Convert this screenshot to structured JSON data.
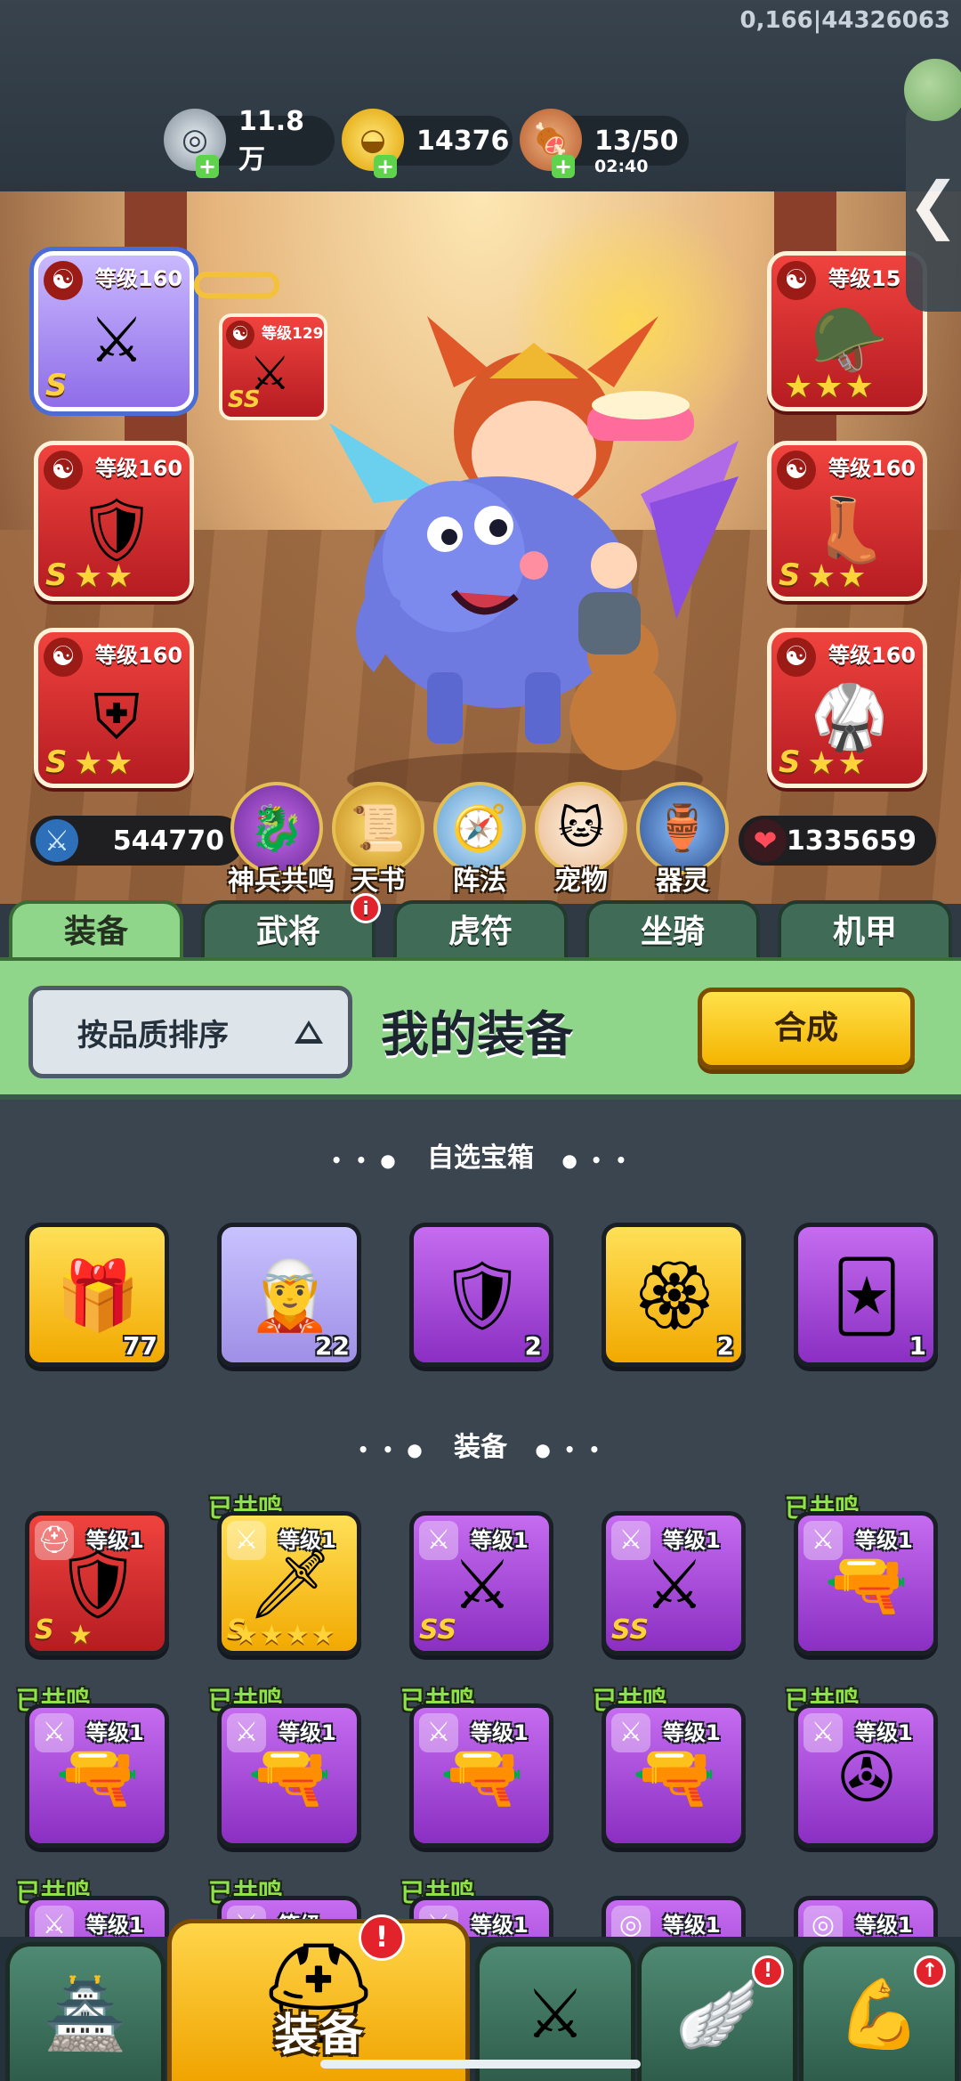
{
  "debug_text": "0,166|44326063",
  "resources": [
    {
      "name": "silver-coin-icon",
      "value": "11.8万",
      "sub": ""
    },
    {
      "name": "gold-ingot-icon",
      "value": "14376",
      "sub": ""
    },
    {
      "name": "meat-stamina-icon",
      "value": "13/50",
      "sub": "02:40"
    }
  ],
  "side_tab_arrow": "❮",
  "equipment_slots": [
    {
      "level": "等级160",
      "grade": "S",
      "stars": 0,
      "icon": "⚔",
      "yin": "☯"
    },
    {
      "level": "等级160",
      "grade": "S",
      "stars": 2,
      "icon": "🛡",
      "yin": "☯"
    },
    {
      "level": "等级160",
      "grade": "S",
      "stars": 2,
      "icon": "⛨",
      "yin": "☯"
    },
    {
      "level": "等级15",
      "grade": "",
      "stars": 3,
      "icon": "🪖",
      "yin": "☯"
    },
    {
      "level": "等级160",
      "grade": "S",
      "stars": 2,
      "icon": "👢",
      "yin": "☯"
    },
    {
      "level": "等级160",
      "grade": "S",
      "stars": 2,
      "icon": "🥋",
      "yin": "☯"
    }
  ],
  "mini_slot": {
    "level": "等级129",
    "grade": "SS",
    "icon": "⚔",
    "yin": "☯"
  },
  "power": "544770",
  "hp": "1335659",
  "features": [
    {
      "label": "神兵共鸣",
      "icon": "🐉"
    },
    {
      "label": "天书",
      "icon": "📜"
    },
    {
      "label": "阵法",
      "icon": "🧭"
    },
    {
      "label": "宠物",
      "icon": "🐱"
    },
    {
      "label": "器灵",
      "icon": "🏺"
    }
  ],
  "category_tabs": [
    "装备",
    "武将",
    "虎符",
    "坐骑",
    "机甲"
  ],
  "tab_badge": "i",
  "sort_label": "按品质排序",
  "panel_title": "我的装备",
  "combine_label": "合成",
  "section_chest": "自选宝箱",
  "section_equip": "装备",
  "section_dots": "• • ●",
  "section_dots_right": "● • •",
  "chests": [
    {
      "color": "yellow",
      "icon": "🎁",
      "count": "77"
    },
    {
      "color": "lavender",
      "icon": "🧝",
      "count": "22"
    },
    {
      "color": "purple",
      "icon": "🛡",
      "count": "2"
    },
    {
      "color": "yellow",
      "icon": "🏵",
      "count": "2"
    },
    {
      "color": "purple",
      "icon": "🃏",
      "count": "1"
    }
  ],
  "resonance_label": "已共鸣",
  "items": [
    {
      "color": "red",
      "level": "等级1",
      "grade": "S",
      "stars": 1,
      "icon": "🛡",
      "tag": "⛑",
      "resonated": false
    },
    {
      "color": "yellow",
      "level": "等级1",
      "grade": "S",
      "stars": 4,
      "icon": "🗡",
      "tag": "⚔",
      "resonated": true
    },
    {
      "color": "purple",
      "level": "等级1",
      "grade": "SS",
      "stars": 0,
      "icon": "⚔",
      "tag": "⚔",
      "resonated": false
    },
    {
      "color": "purple",
      "level": "等级1",
      "grade": "SS",
      "stars": 0,
      "icon": "⚔",
      "tag": "⚔",
      "resonated": false
    },
    {
      "color": "purple",
      "level": "等级1",
      "grade": "",
      "stars": 0,
      "icon": "🔫",
      "tag": "⚔",
      "resonated": true
    },
    {
      "color": "purple",
      "level": "等级1",
      "grade": "",
      "stars": 0,
      "icon": "🔫",
      "tag": "⚔",
      "resonated": true
    },
    {
      "color": "purple",
      "level": "等级1",
      "grade": "",
      "stars": 0,
      "icon": "🔫",
      "tag": "⚔",
      "resonated": true
    },
    {
      "color": "purple",
      "level": "等级1",
      "grade": "",
      "stars": 0,
      "icon": "🔫",
      "tag": "⚔",
      "resonated": true
    },
    {
      "color": "purple",
      "level": "等级1",
      "grade": "",
      "stars": 0,
      "icon": "🔫",
      "tag": "⚔",
      "resonated": true
    },
    {
      "color": "purple",
      "level": "等级1",
      "grade": "",
      "stars": 0,
      "icon": "✇",
      "tag": "⚔",
      "resonated": true
    },
    {
      "color": "purple",
      "level": "等级1",
      "grade": "",
      "stars": 0,
      "icon": "",
      "tag": "⚔",
      "resonated": true
    },
    {
      "color": "purple",
      "level": "等级",
      "grade": "",
      "stars": 0,
      "icon": "",
      "tag": "⚔",
      "resonated": true
    },
    {
      "color": "purple",
      "level": "等级1",
      "grade": "",
      "stars": 0,
      "icon": "",
      "tag": "⚔",
      "resonated": true
    },
    {
      "color": "purple",
      "level": "等级1",
      "grade": "",
      "stars": 0,
      "icon": "",
      "tag": "◎",
      "resonated": false
    },
    {
      "color": "purple",
      "level": "等级1",
      "grade": "",
      "stars": 0,
      "icon": "",
      "tag": "◎",
      "resonated": false
    }
  ],
  "bottom_nav": [
    {
      "name": "nav-city",
      "icon": "🏯",
      "label": "",
      "alert": ""
    },
    {
      "name": "nav-equipment",
      "icon": "⛑",
      "label": "装备",
      "alert": "!"
    },
    {
      "name": "nav-battle",
      "icon": "⚔",
      "label": "",
      "alert": ""
    },
    {
      "name": "nav-heroes",
      "icon": "🪽",
      "label": "",
      "alert": "!"
    },
    {
      "name": "nav-upgrade",
      "icon": "💪",
      "label": "",
      "alert": "↑"
    }
  ]
}
